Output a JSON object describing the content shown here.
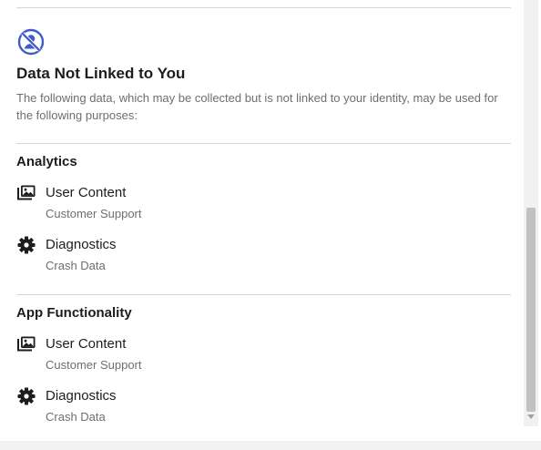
{
  "privacy": {
    "section_title": "Data Not Linked to You",
    "section_description": "The following data, which may be collected but is not linked to your identity, may be used for the following purposes:",
    "section_icon": "person-slash-icon",
    "accent_color": "#3f5cc8",
    "purposes": [
      {
        "title": "Analytics",
        "categories": [
          {
            "icon": "photos-icon",
            "name": "User Content",
            "detail": "Customer Support"
          },
          {
            "icon": "gear-icon",
            "name": "Diagnostics",
            "detail": "Crash Data"
          }
        ]
      },
      {
        "title": "App Functionality",
        "categories": [
          {
            "icon": "photos-icon",
            "name": "User Content",
            "detail": "Customer Support"
          },
          {
            "icon": "gear-icon",
            "name": "Diagnostics",
            "detail": "Crash Data"
          }
        ]
      }
    ]
  }
}
